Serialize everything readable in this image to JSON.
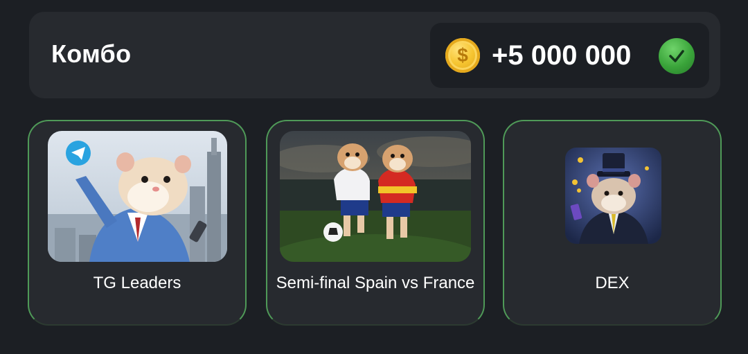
{
  "combo": {
    "title": "Комбо",
    "reward": "+5 000 000",
    "coin_icon": "gold-coin-icon",
    "check_icon": "check-circle-icon",
    "accent": "#4f9a58"
  },
  "cards": [
    {
      "label": "TG Leaders",
      "image": "hamster-in-suit-with-telegram-logo",
      "status": "found"
    },
    {
      "label": "Semi-final Spain vs France",
      "image": "two-hamsters-playing-football",
      "status": "found"
    },
    {
      "label": "DEX",
      "image": "hamster-in-top-hat",
      "status": "found"
    }
  ]
}
